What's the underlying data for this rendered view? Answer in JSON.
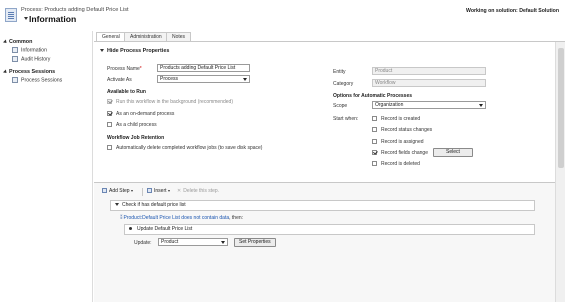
{
  "header": {
    "process_line": "Process: Products adding Default Price List",
    "title": "Information",
    "working_on": "Working on solution: Default Solution"
  },
  "sidebar": {
    "common_label": "Common",
    "common_items": [
      "Information",
      "Audit History"
    ],
    "process_sessions_label": "Process Sessions",
    "process_sessions_items": [
      "Process Sessions"
    ]
  },
  "tabs": [
    "General",
    "Administration",
    "Notes"
  ],
  "section_title": "Hide Process Properties",
  "left": {
    "process_name_label": "Process Name",
    "process_name_value": "Products adding Default Price List",
    "activate_as_label": "Activate As",
    "activate_as_value": "Process",
    "available_title": "Available to Run",
    "run_background": "Run this workflow in the background (recommended)",
    "on_demand": "As an on-demand process",
    "child_process": "As a child process",
    "retention_title": "Workflow Job Retention",
    "auto_delete": "Automatically delete completed workflow jobs (to save disk space)"
  },
  "right": {
    "entity_label": "Entity",
    "entity_value": "Product",
    "category_label": "Category",
    "category_value": "Workflow",
    "options_title": "Options for Automatic Processes",
    "scope_label": "Scope",
    "scope_value": "Organization",
    "start_when_label": "Start when:",
    "triggers": [
      "Record is created",
      "Record status changes",
      "Record is assigned",
      "Record fields change",
      "Record is deleted"
    ],
    "select_button": "Select"
  },
  "steps": {
    "add_step": "Add Step",
    "insert": "Insert",
    "delete": "Delete this step.",
    "check_step": "Check if has default price list",
    "condition_link": "Product:Default Price List does not contain data",
    "condition_then": ", then:",
    "action_step": "Update Default Price List",
    "update_label": "Update:",
    "update_value": "Product",
    "set_properties": "Set Properties"
  }
}
